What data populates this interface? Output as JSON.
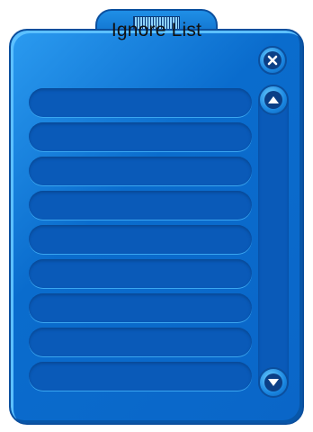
{
  "window": {
    "title": "Ignore List"
  },
  "list": {
    "rows": [
      "",
      "",
      "",
      "",
      "",
      "",
      "",
      "",
      ""
    ]
  },
  "icons": {
    "close": "close-icon",
    "scroll_up": "arrow-up-icon",
    "scroll_down": "arrow-down-icon",
    "grip": "grip-icon"
  },
  "colors": {
    "panel": "#0a6ccd",
    "row": "#0a5ab8",
    "border": "#0b4f9e"
  }
}
